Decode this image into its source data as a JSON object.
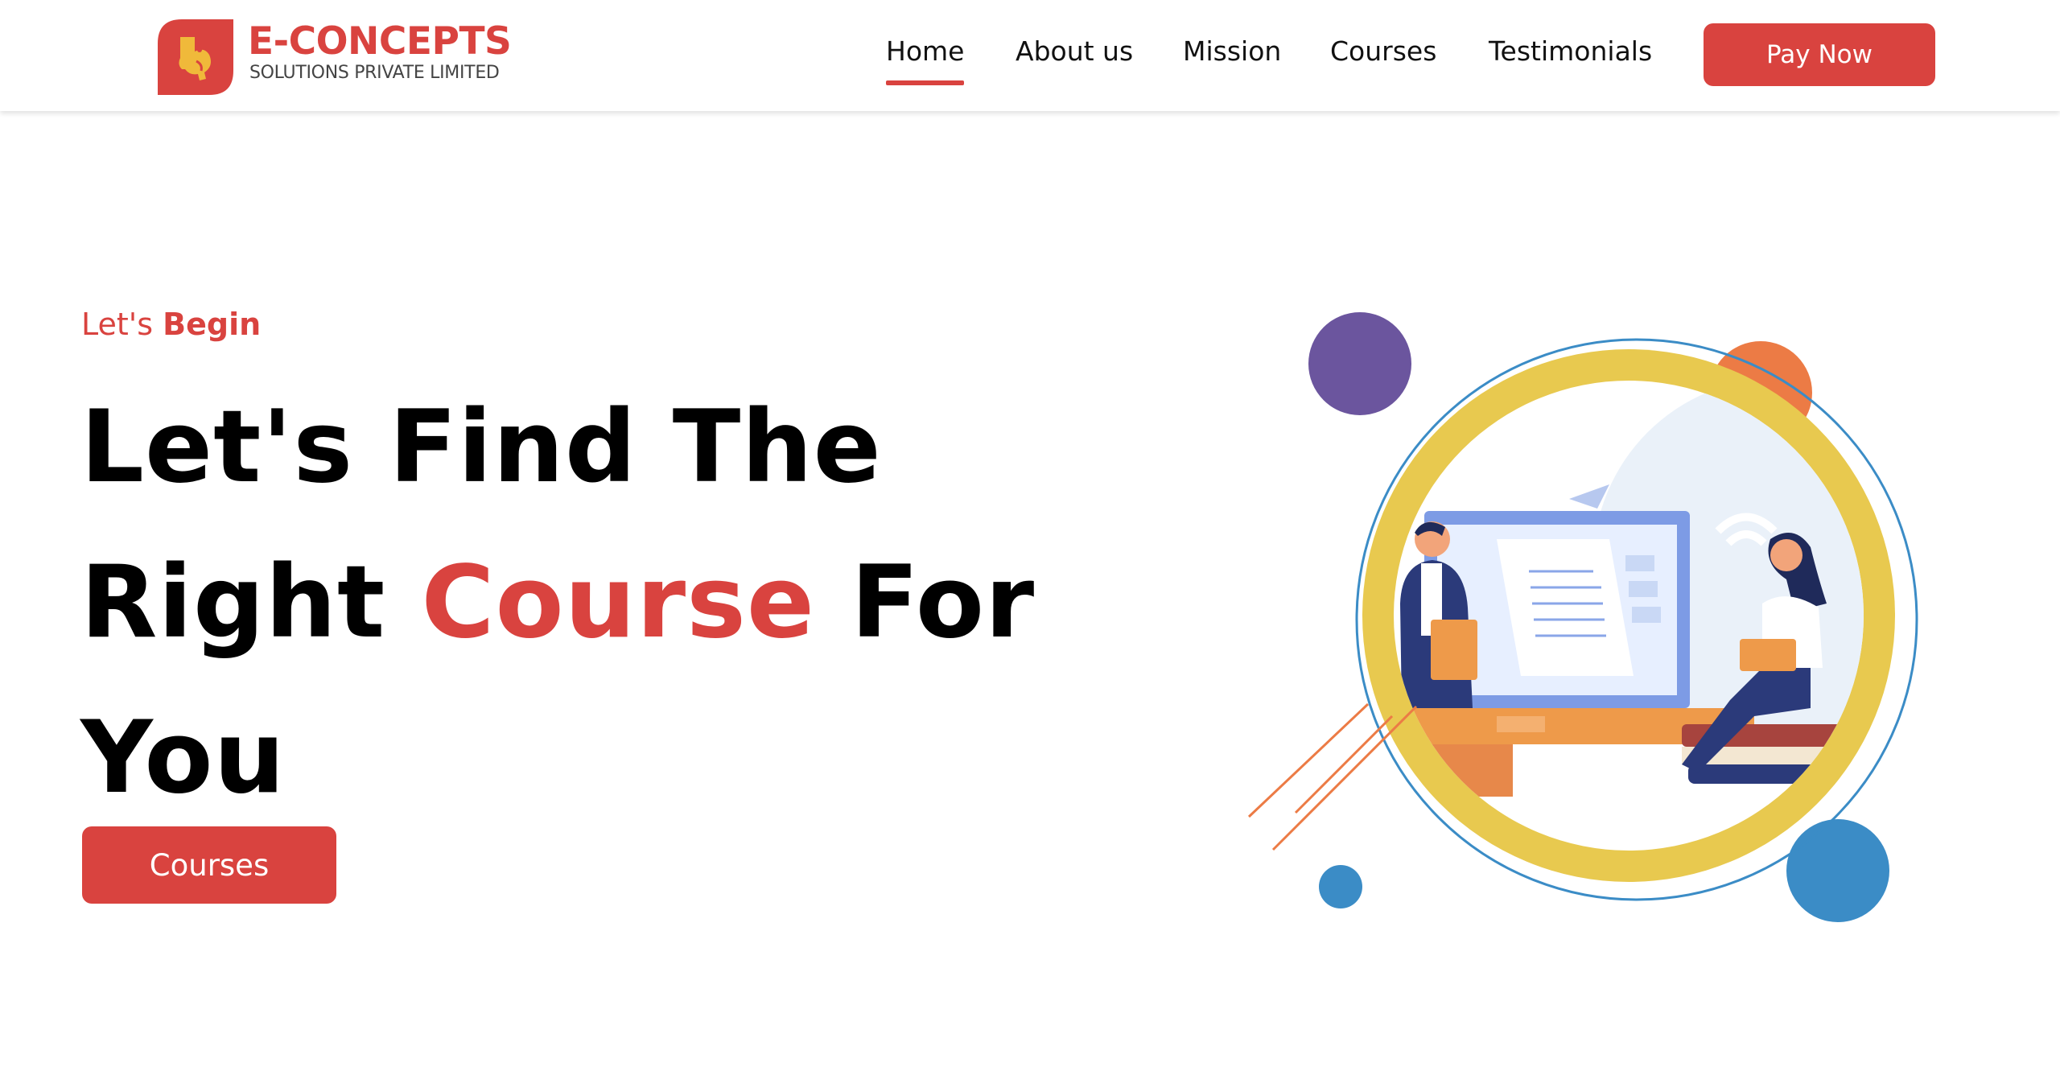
{
  "brand": {
    "name": "E-CONCEPTS",
    "subtitle": "SOLUTIONS PRIVATE LIMITED",
    "logo_icon": "elephant-logo-icon",
    "color": "#d9433f"
  },
  "nav": {
    "items": [
      {
        "label": "Home",
        "active": true
      },
      {
        "label": "About us",
        "active": false
      },
      {
        "label": "Mission",
        "active": false
      },
      {
        "label": "Courses",
        "active": false
      },
      {
        "label": "Testimonials",
        "active": false
      }
    ],
    "cta_label": "Pay Now"
  },
  "hero": {
    "eyebrow_prefix": "Let's",
    "eyebrow_strong": "Begin",
    "title_line1": "Let's Find The",
    "title_line2_a": "Right",
    "title_accent": "Course",
    "title_line2_b": "For",
    "title_line3": "You",
    "cta_label": "Courses"
  },
  "illustration": {
    "name": "online-learning-illustration",
    "colors": {
      "ring": "#e8c94f",
      "purple": "#6b559e",
      "orange": "#ec7b45",
      "blue": "#3b8cc6",
      "navy": "#2b3a7a"
    }
  }
}
